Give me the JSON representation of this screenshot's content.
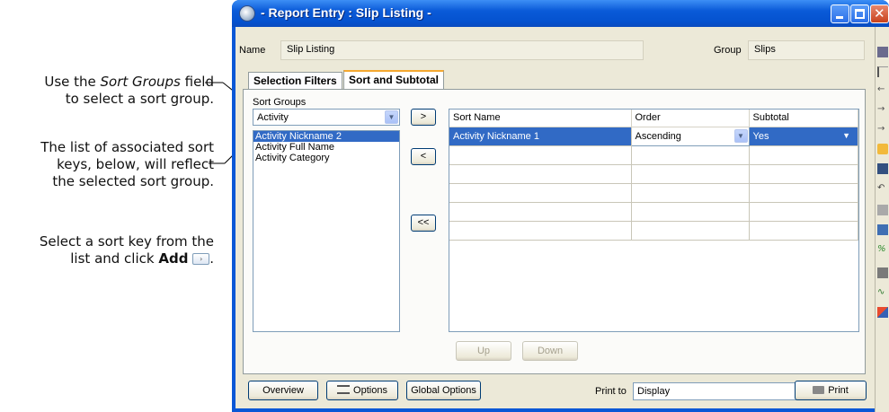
{
  "annotations": {
    "a1_prefix": "Use the ",
    "a1_em": "Sort Groups",
    "a1_suffix": " field",
    "a1_line2": "to select a sort group.",
    "a2_line1": "The list of associated sort",
    "a2_line2": "keys, below, will reflect",
    "a2_line3": "the selected sort group.",
    "a3_line1": "Select a sort key from the",
    "a3_prefix": "list and click ",
    "a3_bold": "Add",
    "a3_suffix": "."
  },
  "window": {
    "title": "- Report Entry : Slip Listing -"
  },
  "header": {
    "name_label": "Name",
    "name_value": "Slip Listing",
    "group_label": "Group",
    "group_value": "Slips"
  },
  "tabs": [
    "Selection Filters",
    "Sort and Subtotal"
  ],
  "sort_groups": {
    "label": "Sort Groups",
    "selected": "Activity",
    "items": [
      "Activity Nickname 2",
      "Activity Full Name",
      "Activity Category"
    ]
  },
  "move_buttons": {
    "add": ">",
    "remove": "<",
    "remove_all": "<<"
  },
  "grid": {
    "columns": [
      "Sort Name",
      "Order",
      "Subtotal"
    ],
    "rows": [
      {
        "sort_name": "Activity Nickname 1",
        "order": "Ascending",
        "subtotal": "Yes"
      }
    ]
  },
  "order_buttons": {
    "up": "Up",
    "down": "Down"
  },
  "footer": {
    "overview": "Overview",
    "options": "Options",
    "global_options": "Global Options",
    "print_to_label": "Print to",
    "print_to_value": "Display",
    "print": "Print"
  }
}
